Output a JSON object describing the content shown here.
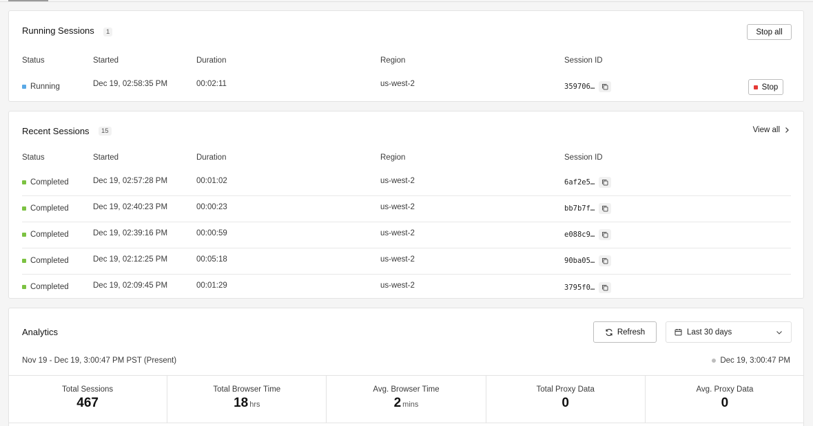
{
  "colors": {
    "running": "#5aa9e6",
    "completed": "#7cc242",
    "stop": "#e53935"
  },
  "running": {
    "title": "Running Sessions",
    "count": "1",
    "stop_all_label": "Stop all",
    "columns": [
      "Status",
      "Started",
      "Duration",
      "Region",
      "Session ID"
    ],
    "rows": [
      {
        "status": "Running",
        "started": "Dec 19, 02:58:35 PM",
        "duration": "00:02:11",
        "region": "us-west-2",
        "session_id": "359706…",
        "action": "Stop"
      }
    ]
  },
  "recent": {
    "title": "Recent Sessions",
    "count": "15",
    "view_all_label": "View all",
    "columns": [
      "Status",
      "Started",
      "Duration",
      "Region",
      "Session ID"
    ],
    "rows": [
      {
        "status": "Completed",
        "started": "Dec 19, 02:57:28 PM",
        "duration": "00:01:02",
        "region": "us-west-2",
        "session_id": "6af2e5…"
      },
      {
        "status": "Completed",
        "started": "Dec 19, 02:40:23 PM",
        "duration": "00:00:23",
        "region": "us-west-2",
        "session_id": "bb7b7f…"
      },
      {
        "status": "Completed",
        "started": "Dec 19, 02:39:16 PM",
        "duration": "00:00:59",
        "region": "us-west-2",
        "session_id": "e088c9…"
      },
      {
        "status": "Completed",
        "started": "Dec 19, 02:12:25 PM",
        "duration": "00:05:18",
        "region": "us-west-2",
        "session_id": "90ba05…"
      },
      {
        "status": "Completed",
        "started": "Dec 19, 02:09:45 PM",
        "duration": "00:01:29",
        "region": "us-west-2",
        "session_id": "3795f0…"
      }
    ]
  },
  "analytics": {
    "title": "Analytics",
    "refresh_label": "Refresh",
    "date_range": "Last 30 days",
    "range_text": "Nov 19 - Dec 19, 3:00:47 PM PST (Present)",
    "updated_text": "Dec 19, 3:00:47 PM",
    "metrics": [
      {
        "label": "Total Sessions",
        "value": "467",
        "unit": ""
      },
      {
        "label": "Total Browser Time",
        "value": "18",
        "unit": "hrs"
      },
      {
        "label": "Avg. Browser Time",
        "value": "2",
        "unit": "mins"
      },
      {
        "label": "Total Proxy Data",
        "value": "0",
        "unit": ""
      },
      {
        "label": "Avg. Proxy Data",
        "value": "0",
        "unit": ""
      }
    ]
  }
}
